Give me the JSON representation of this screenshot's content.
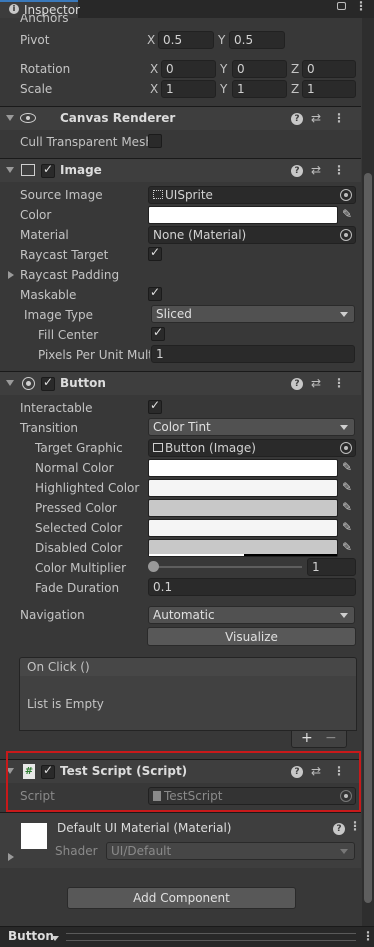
{
  "tab": {
    "title": "Inspector"
  },
  "transform": {
    "anchors_label": "Anchors",
    "pivot": {
      "label": "Pivot",
      "x_axis": "X",
      "x": "0.5",
      "y_axis": "Y",
      "y": "0.5"
    },
    "rotation": {
      "label": "Rotation",
      "x_axis": "X",
      "x": "0",
      "y_axis": "Y",
      "y": "0",
      "z_axis": "Z",
      "z": "0"
    },
    "scale": {
      "label": "Scale",
      "x_axis": "X",
      "x": "1",
      "y_axis": "Y",
      "y": "1",
      "z_axis": "Z",
      "z": "1"
    }
  },
  "canvas_renderer": {
    "title": "Canvas Renderer",
    "cull_label": "Cull Transparent Mesh"
  },
  "image": {
    "title": "Image",
    "source_image_label": "Source Image",
    "source_image_value": "UISprite",
    "color_label": "Color",
    "material_label": "Material",
    "material_value": "None (Material)",
    "raycast_target_label": "Raycast Target",
    "raycast_padding_label": "Raycast Padding",
    "maskable_label": "Maskable",
    "image_type_label": "Image Type",
    "image_type_value": "Sliced",
    "fill_center_label": "Fill Center",
    "ppu_label": "Pixels Per Unit Multi",
    "ppu_value": "1"
  },
  "button": {
    "title": "Button",
    "interactable_label": "Interactable",
    "transition_label": "Transition",
    "transition_value": "Color Tint",
    "target_graphic_label": "Target Graphic",
    "target_graphic_value": "Button (Image)",
    "normal_color_label": "Normal Color",
    "highlighted_color_label": "Highlighted Color",
    "pressed_color_label": "Pressed Color",
    "selected_color_label": "Selected Color",
    "disabled_color_label": "Disabled Color",
    "color_multiplier_label": "Color Multiplier",
    "color_multiplier_value": "1",
    "fade_duration_label": "Fade Duration",
    "fade_duration_value": "0.1",
    "navigation_label": "Navigation",
    "navigation_value": "Automatic",
    "visualize_label": "Visualize",
    "on_click_label": "On Click ()",
    "list_empty_label": "List is Empty",
    "add_label": "+",
    "remove_label": "−"
  },
  "test_script": {
    "title": "Test Script (Script)",
    "script_label": "Script",
    "script_value": "TestScript",
    "icon_glyph": "#"
  },
  "material": {
    "title": "Default UI Material (Material)",
    "shader_label": "Shader",
    "shader_value": "UI/Default"
  },
  "add_component_label": "Add Component",
  "footer": {
    "object_label": "Button"
  },
  "colors": {
    "highlight": "#c8191a",
    "white": "#ffffff",
    "pressed": "#c8c8c8",
    "selected": "#f5f5f5",
    "disabled": "#c8c8c8"
  }
}
